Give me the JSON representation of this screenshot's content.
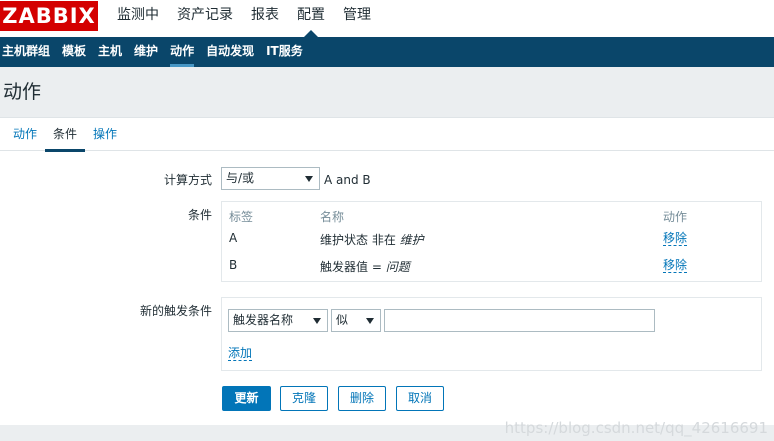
{
  "logo": "ZABBIX",
  "main_menu": [
    {
      "label": "监测中"
    },
    {
      "label": "资产记录"
    },
    {
      "label": "报表"
    },
    {
      "label": "配置"
    },
    {
      "label": "管理"
    }
  ],
  "sub_menu": [
    {
      "label": "主机群组"
    },
    {
      "label": "模板"
    },
    {
      "label": "主机"
    },
    {
      "label": "维护"
    },
    {
      "label": "动作"
    },
    {
      "label": "自动发现"
    },
    {
      "label": "IT服务"
    }
  ],
  "page_title": "动作",
  "tabs": [
    {
      "label": "动作"
    },
    {
      "label": "条件"
    },
    {
      "label": "操作"
    }
  ],
  "form": {
    "calc_label": "计算方式",
    "calc_value": "与/或",
    "calc_expression": "A and B",
    "conditions_label": "条件",
    "conditions_headers": {
      "label": "标签",
      "name": "名称",
      "action": "动作"
    },
    "conditions": [
      {
        "label": "A",
        "name_prefix": "维护状态 非在 ",
        "name_value": "维护",
        "action": "移除"
      },
      {
        "label": "B",
        "name_prefix": "触发器值 = ",
        "name_value": "问题",
        "action": "移除"
      }
    ],
    "new_condition_label": "新的触发条件",
    "new_condition_type": "触发器名称",
    "new_condition_operator": "似",
    "new_condition_value": "",
    "add_link": "添加"
  },
  "buttons": {
    "update": "更新",
    "clone": "克隆",
    "delete": "删除",
    "cancel": "取消"
  },
  "watermark": "https://blog.csdn.net/qq_42616691",
  "colors": {
    "logo_bg": "#d40000",
    "subnav_bg": "#0a466a",
    "link": "#0275b8"
  }
}
